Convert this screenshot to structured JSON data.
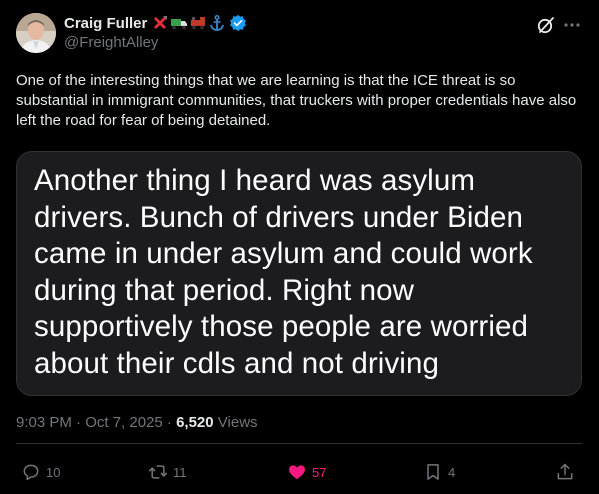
{
  "author": {
    "name": "Craig Fuller",
    "handle": "@FreightAlley",
    "name_emojis": [
      "cross-mark",
      "truck",
      "locomotive",
      "anchor"
    ],
    "verified": true
  },
  "tweet": {
    "text": "One of the interesting things that we are learning is that the ICE threat is so substantial in immigrant communities, that truckers with proper credentials have also left the road for fear of being detained.",
    "image_text": "Another thing I heard was asylum\ndrivers. Bunch of drivers under Biden\ncame in under asylum and could work\nduring that period.  Right now\nsupportively those people are worried\nabout their cdls and not driving",
    "timestamp": "9:03 PM · Oct 7, 2025 · ",
    "views_count": "6,520",
    "views_label": " Views"
  },
  "actions": {
    "replies": "10",
    "retweets": "11",
    "likes": "57",
    "bookmarks": "4"
  },
  "colors": {
    "background": "#000000",
    "text": "#e7e9ea",
    "muted": "#71767b",
    "like": "#f91880",
    "verified": "#1d9bf0"
  }
}
